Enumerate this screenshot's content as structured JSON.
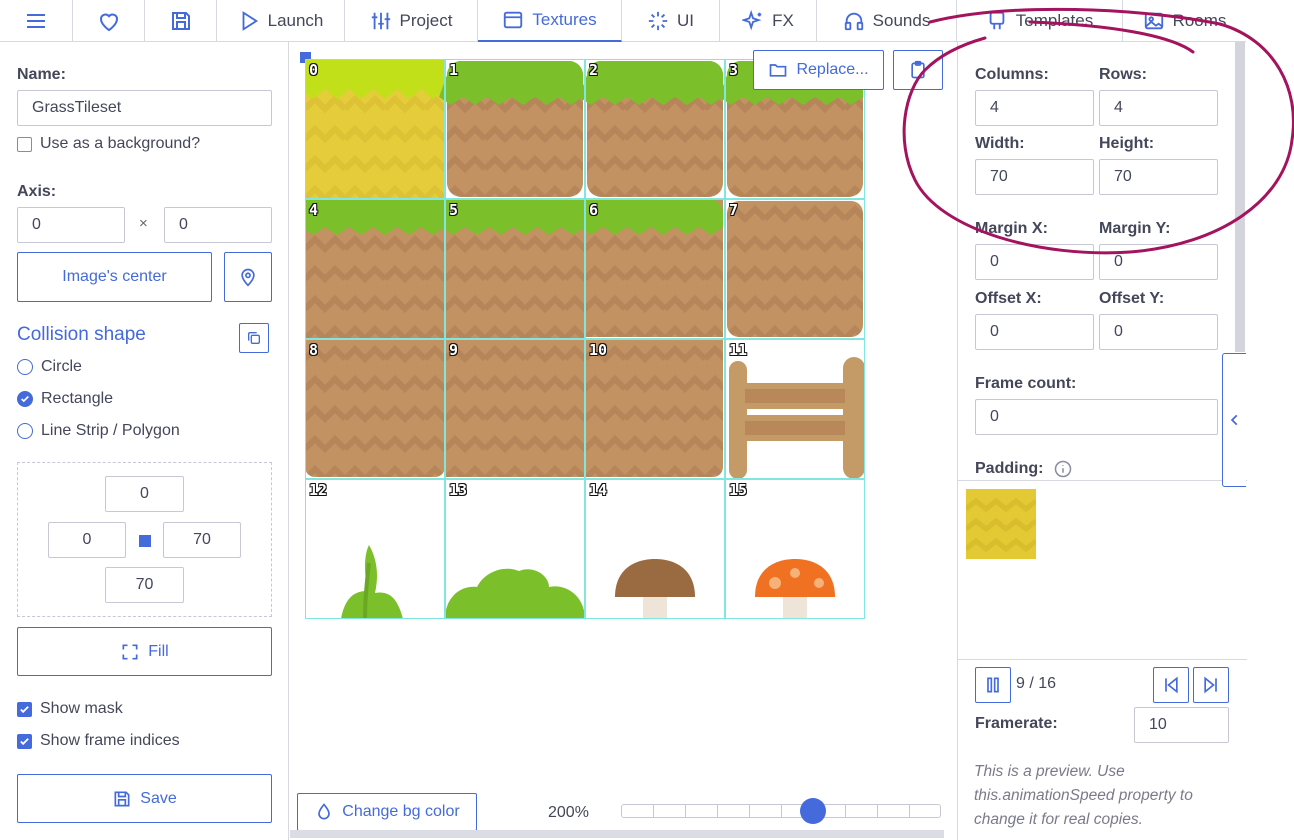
{
  "nav": {
    "tabs": [
      {
        "label": "",
        "icon": "menu-icon"
      },
      {
        "label": "",
        "icon": "heart-icon"
      },
      {
        "label": "",
        "icon": "save-icon"
      },
      {
        "label": "Launch",
        "icon": "play-icon"
      },
      {
        "label": "Project",
        "icon": "sliders-icon"
      },
      {
        "label": "Textures",
        "icon": "texture-icon"
      },
      {
        "label": "UI",
        "icon": "cursor-icon"
      },
      {
        "label": "FX",
        "icon": "sparkles-icon"
      },
      {
        "label": "Sounds",
        "icon": "headphones-icon"
      },
      {
        "label": "Templates",
        "icon": "template-icon"
      },
      {
        "label": "Rooms",
        "icon": "image-icon"
      }
    ],
    "active_tab": "Textures"
  },
  "left": {
    "name_label": "Name:",
    "name_value": "GrassTileset",
    "bg_check_label": "Use as a background?",
    "axis_label": "Axis:",
    "axis_x": "0",
    "axis_sep": "×",
    "axis_y": "0",
    "center_button": "Image's center",
    "collision_title": "Collision shape",
    "shapes": [
      "Circle",
      "Rectangle",
      "Line Strip / Polygon"
    ],
    "selected_shape": "Rectangle",
    "rect_top": "0",
    "rect_left": "0",
    "rect_right": "70",
    "rect_bottom": "70",
    "fill_button": "Fill",
    "show_mask": "Show mask",
    "show_indices": "Show frame indices",
    "save_button": "Save"
  },
  "canvas": {
    "replace_button": "Replace...",
    "bg_button": "Change bg color",
    "zoom": "200%",
    "zoom_level": 0.6,
    "frame_indices": [
      "0",
      "1",
      "2",
      "3",
      "4",
      "5",
      "6",
      "7",
      "8",
      "9",
      "10",
      "11",
      "12",
      "13",
      "14",
      "15"
    ]
  },
  "right": {
    "columns_label": "Columns:",
    "columns_value": "4",
    "rows_label": "Rows:",
    "rows_value": "4",
    "width_label": "Width:",
    "width_value": "70",
    "height_label": "Height:",
    "height_value": "70",
    "marginx_label": "Margin X:",
    "marginx_value": "0",
    "marginy_label": "Margin Y:",
    "marginy_value": "0",
    "offsetx_label": "Offset X:",
    "offsetx_value": "0",
    "offsety_label": "Offset Y:",
    "offsety_value": "0",
    "framecount_label": "Frame count:",
    "framecount_value": "0",
    "padding_label": "Padding:",
    "frame_counter": "9 / 16",
    "framerate_label": "Framerate:",
    "framerate_value": "10",
    "note": "This is a preview. Use this.animationSpeed property to change it for real copies."
  },
  "colors": {
    "accent": "#446adb",
    "annotation": "#a3135e",
    "grid": "#7fe6e0",
    "dirt": "#c29262",
    "grass": "#7bbf2a"
  }
}
